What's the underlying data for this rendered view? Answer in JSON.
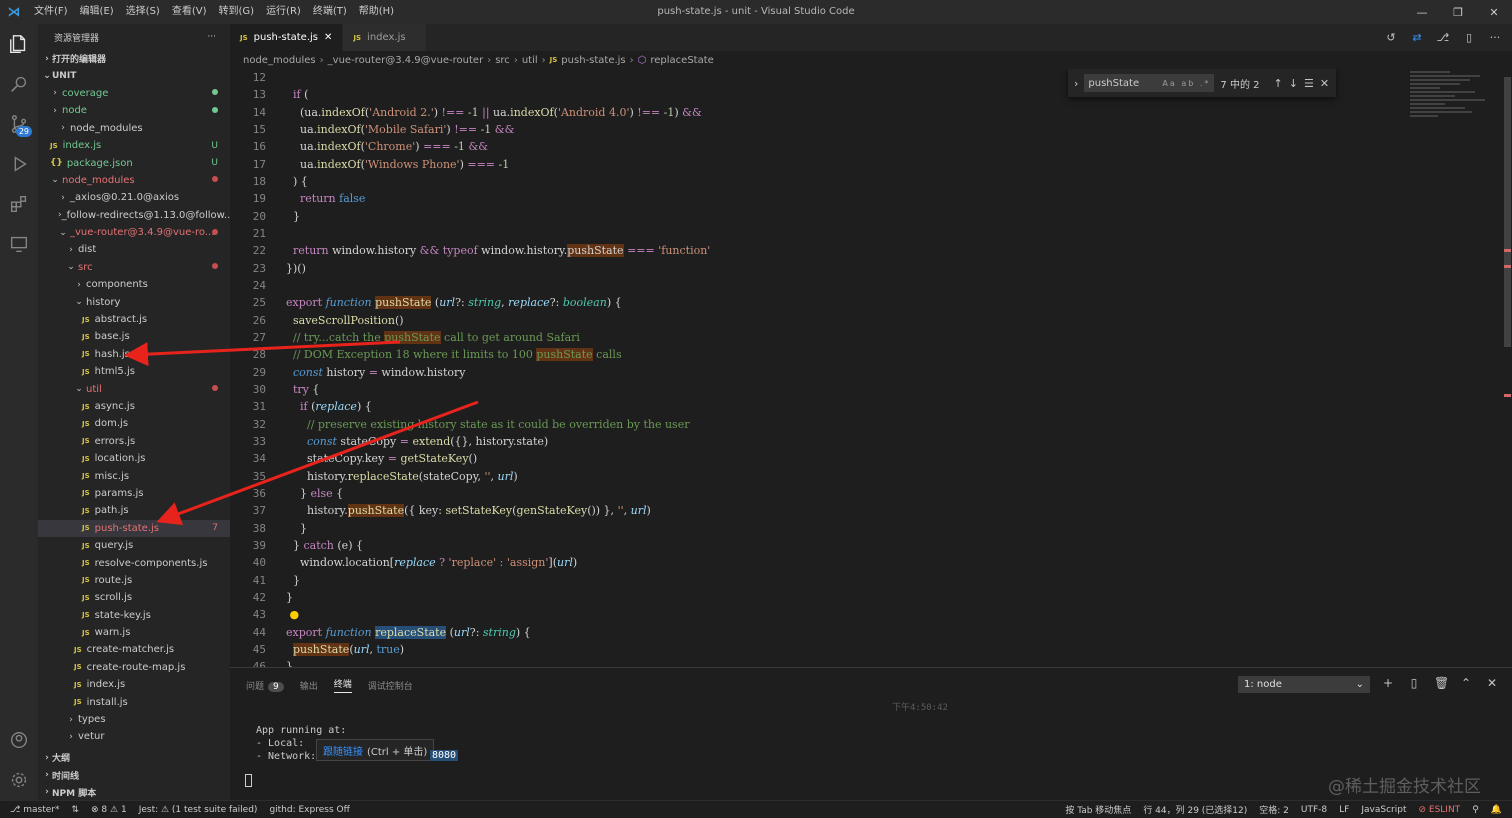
{
  "titlebar": {
    "menu": [
      "文件(F)",
      "编辑(E)",
      "选择(S)",
      "查看(V)",
      "转到(G)",
      "运行(R)",
      "终端(T)",
      "帮助(H)"
    ],
    "title": "push-state.js - unit - Visual Studio Code"
  },
  "activity": {
    "scm_badge": "29"
  },
  "sidebar": {
    "title": "资源管理器",
    "open_editors": "打开的编辑器",
    "root": "UNIT",
    "items": [
      {
        "indent": 0,
        "type": "folder",
        "open": false,
        "label": "coverage",
        "color": "green",
        "flag": "dot"
      },
      {
        "indent": 0,
        "type": "folder",
        "open": false,
        "label": "node",
        "color": "green",
        "flag": "dot"
      },
      {
        "indent": 1,
        "type": "folder",
        "open": false,
        "label": "node_modules",
        "color": "",
        "flag": ""
      },
      {
        "indent": 0,
        "type": "js",
        "label": "index.js",
        "color": "green",
        "flag": "U"
      },
      {
        "indent": 0,
        "type": "json",
        "label": "package.json",
        "color": "green",
        "flag": "U"
      },
      {
        "indent": 0,
        "type": "folder",
        "open": true,
        "label": "node_modules",
        "color": "red",
        "flag": "dot"
      },
      {
        "indent": 1,
        "type": "folder",
        "open": false,
        "label": "_axios@0.21.0@axios",
        "color": "",
        "flag": ""
      },
      {
        "indent": 1,
        "type": "folder",
        "open": false,
        "label": "_follow-redirects@1.13.0@follow...",
        "color": "",
        "flag": ""
      },
      {
        "indent": 1,
        "type": "folder",
        "open": true,
        "label": "_vue-router@3.4.9@vue-ro...",
        "color": "red",
        "flag": "dot"
      },
      {
        "indent": 2,
        "type": "folder",
        "open": false,
        "label": "dist",
        "color": "",
        "flag": ""
      },
      {
        "indent": 2,
        "type": "folder",
        "open": true,
        "label": "src",
        "color": "red",
        "flag": "dot"
      },
      {
        "indent": 3,
        "type": "folder",
        "open": false,
        "label": "components",
        "color": "",
        "flag": ""
      },
      {
        "indent": 3,
        "type": "folder",
        "open": true,
        "label": "history",
        "color": "",
        "flag": ""
      },
      {
        "indent": 4,
        "type": "js",
        "label": "abstract.js",
        "color": "",
        "flag": ""
      },
      {
        "indent": 4,
        "type": "js",
        "label": "base.js",
        "color": "",
        "flag": ""
      },
      {
        "indent": 4,
        "type": "js",
        "label": "hash.js",
        "color": "",
        "flag": ""
      },
      {
        "indent": 4,
        "type": "js",
        "label": "html5.js",
        "color": "",
        "flag": ""
      },
      {
        "indent": 3,
        "type": "folder",
        "open": true,
        "label": "util",
        "color": "red",
        "flag": "dot"
      },
      {
        "indent": 4,
        "type": "js",
        "label": "async.js",
        "color": "",
        "flag": ""
      },
      {
        "indent": 4,
        "type": "js",
        "label": "dom.js",
        "color": "",
        "flag": ""
      },
      {
        "indent": 4,
        "type": "js",
        "label": "errors.js",
        "color": "",
        "flag": ""
      },
      {
        "indent": 4,
        "type": "js",
        "label": "location.js",
        "color": "",
        "flag": ""
      },
      {
        "indent": 4,
        "type": "js",
        "label": "misc.js",
        "color": "",
        "flag": ""
      },
      {
        "indent": 4,
        "type": "js",
        "label": "params.js",
        "color": "",
        "flag": ""
      },
      {
        "indent": 4,
        "type": "js",
        "label": "path.js",
        "color": "",
        "flag": ""
      },
      {
        "indent": 4,
        "type": "js",
        "label": "push-state.js",
        "color": "red",
        "flag": "7",
        "selected": true
      },
      {
        "indent": 4,
        "type": "js",
        "label": "query.js",
        "color": "",
        "flag": ""
      },
      {
        "indent": 4,
        "type": "js",
        "label": "resolve-components.js",
        "color": "",
        "flag": ""
      },
      {
        "indent": 4,
        "type": "js",
        "label": "route.js",
        "color": "",
        "flag": ""
      },
      {
        "indent": 4,
        "type": "js",
        "label": "scroll.js",
        "color": "",
        "flag": ""
      },
      {
        "indent": 4,
        "type": "js",
        "label": "state-key.js",
        "color": "",
        "flag": ""
      },
      {
        "indent": 4,
        "type": "js",
        "label": "warn.js",
        "color": "",
        "flag": ""
      },
      {
        "indent": 3,
        "type": "js",
        "label": "create-matcher.js",
        "color": "",
        "flag": ""
      },
      {
        "indent": 3,
        "type": "js",
        "label": "create-route-map.js",
        "color": "",
        "flag": ""
      },
      {
        "indent": 3,
        "type": "js",
        "label": "index.js",
        "color": "",
        "flag": ""
      },
      {
        "indent": 3,
        "type": "js",
        "label": "install.js",
        "color": "",
        "flag": ""
      },
      {
        "indent": 2,
        "type": "folder",
        "open": false,
        "label": "types",
        "color": "",
        "flag": ""
      },
      {
        "indent": 2,
        "type": "folder",
        "open": false,
        "label": "vetur",
        "color": "",
        "flag": ""
      }
    ],
    "outline": "大纲",
    "timeline": "时间线",
    "npm": "NPM 脚本"
  },
  "tabs": [
    {
      "label": "push-state.js",
      "active": true
    },
    {
      "label": "index.js",
      "active": false
    }
  ],
  "breadcrumb": [
    "node_modules",
    "_vue-router@3.4.9@vue-router",
    "src",
    "util",
    "push-state.js",
    "replaceState"
  ],
  "find": {
    "query": "pushState",
    "options": "Aa ab .*",
    "count": "7 中的 2"
  },
  "editor": {
    "line_numbers": [
      "12",
      "13",
      "14",
      "15",
      "16",
      "17",
      "18",
      "19",
      "20",
      "21",
      "22",
      "23",
      "24",
      "25",
      "26",
      "27",
      "28",
      "29",
      "30",
      "31",
      "32",
      "33",
      "34",
      "35",
      "36",
      "37",
      "38",
      "39",
      "40",
      "41",
      "42",
      "43",
      "44",
      "45",
      "46"
    ]
  },
  "panel": {
    "tabs": [
      "问题",
      "输出",
      "终端",
      "调试控制台"
    ],
    "problems_count": "9",
    "terminal_select": "1: node",
    "time": "下午4:50:42",
    "terminal_lines": [
      "App running at:",
      "- Local:",
      "- Network:"
    ],
    "tooltip_link": "跟随链接",
    "tooltip_hint": "(Ctrl + 单击)",
    "port": "8080",
    "watermark": "@稀土掘金技术社区"
  },
  "status": {
    "branch": "master*",
    "errors": "⊗ 8 ⚠ 1",
    "jest": "Jest: ⚠ (1 test suite failed)",
    "githd": "githd: Express Off",
    "tab_focus": "按 Tab 移动焦点",
    "position": "行 44，列 29 (已选择12)",
    "spaces": "空格: 2",
    "encoding": "UTF-8",
    "eol": "LF",
    "language": "JavaScript",
    "eslint": "⊘ ESLINT"
  }
}
